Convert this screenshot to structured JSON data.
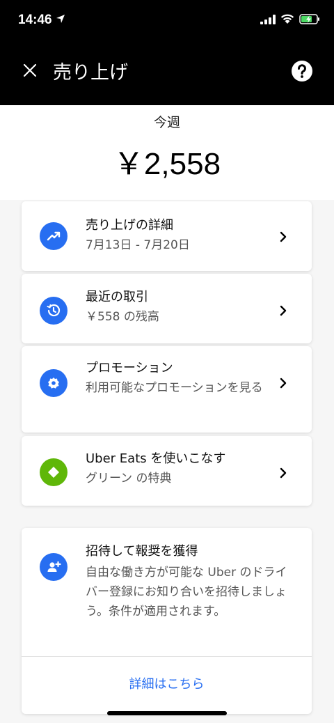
{
  "status_bar": {
    "time": "14:46"
  },
  "header": {
    "title": "売り上げ"
  },
  "summary": {
    "period": "今週",
    "amount": "￥2,558"
  },
  "rows": [
    {
      "title": "売り上げの詳細",
      "subtitle": "7月13日 - 7月20日",
      "icon": "trend-up-icon",
      "icon_color": "#276ef1"
    },
    {
      "title": "最近の取引",
      "subtitle": "￥558 の残高",
      "icon": "history-icon",
      "icon_color": "#276ef1"
    },
    {
      "title": "プロモーション",
      "subtitle": "利用可能なプロモーションを見る",
      "icon": "gear-icon",
      "icon_color": "#276ef1"
    },
    {
      "title": "Uber Eats を使いこなす",
      "subtitle": "グリーン の特典",
      "icon": "diamond-icon",
      "icon_color": "#5fb709"
    }
  ],
  "invite": {
    "title": "招待して報奨を獲得",
    "body": "自由な働き方が可能な Uber のドライバー登録にお知り合いを招待しましょう。条件が適用されます。",
    "link": "詳細はこちら",
    "icon": "add-person-icon",
    "icon_color": "#276ef1"
  },
  "colors": {
    "link": "#276ef1",
    "green": "#5fb709",
    "blue": "#276ef1"
  }
}
